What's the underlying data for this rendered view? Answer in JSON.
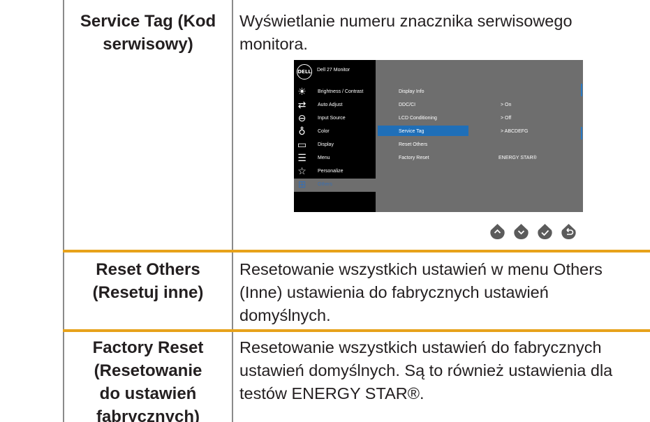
{
  "rows": [
    {
      "label": "Service Tag (Kod serwisowy)",
      "label_lines": [
        "Service Tag (Kod",
        "serwisowy)"
      ],
      "description_lines": [
        "Wyświetlanie numeru znacznika serwisowego",
        "monitora."
      ]
    },
    {
      "label": "Reset Others (Resetuj inne)",
      "label_lines": [
        "Reset Others",
        "(Resetuj inne)"
      ],
      "description_lines": [
        "Resetowanie wszystkich ustawień w menu Others",
        "(Inne) ustawienia do fabrycznych ustawień",
        "domyślnych."
      ]
    },
    {
      "label": "Factory Reset (Resetowanie do ustawień fabrycznych)",
      "label_lines": [
        "Factory Reset",
        "(Resetowanie",
        "do ustawień",
        "fabrycznych)"
      ],
      "description_lines": [
        "Resetowanie wszystkich ustawień do fabrycznych",
        "ustawień domyślnych. Są to również ustawienia dla",
        "testów ENERGY STAR®."
      ]
    }
  ],
  "osd": {
    "logo": "DELL",
    "title": "Dell 27 Monitor",
    "menu": [
      {
        "label": "Brightness / Contrast",
        "icon": "brightness-icon",
        "glyph": "☀"
      },
      {
        "label": "Auto Adjust",
        "icon": "auto-adjust-icon",
        "glyph": "⇄"
      },
      {
        "label": "Input Source",
        "icon": "input-source-icon",
        "glyph": "⊖"
      },
      {
        "label": "Color",
        "icon": "color-icon",
        "glyph": "♁"
      },
      {
        "label": "Display",
        "icon": "display-icon",
        "glyph": "▭"
      },
      {
        "label": "Menu",
        "icon": "menu-icon",
        "glyph": "☰"
      },
      {
        "label": "Personalize",
        "icon": "personalize-icon",
        "glyph": "☆"
      },
      {
        "label": "Others",
        "icon": "others-icon",
        "glyph": "⊞",
        "selected": true
      }
    ],
    "options": [
      "Display Info",
      "DDC/CI",
      "LCD Conditioning",
      "Service Tag",
      "Reset Others",
      "Factory Reset"
    ],
    "values": {
      "ddc_ci": "> On",
      "lcd_conditioning": "> Off",
      "service_tag": "> ABCDEFG",
      "factory_reset": "ENERGY STAR®"
    },
    "selected_option": "Service Tag",
    "nav_buttons": [
      "up-icon",
      "down-icon",
      "check-icon",
      "back-icon"
    ]
  },
  "colors": {
    "border": "#8a8a8a",
    "accent_rule": "#e7a21b",
    "osd_bg": "#6e6e6e",
    "osd_panel": "#000000",
    "osd_highlight": "#1f6fb8",
    "nav_button": "#5b5b5b"
  }
}
